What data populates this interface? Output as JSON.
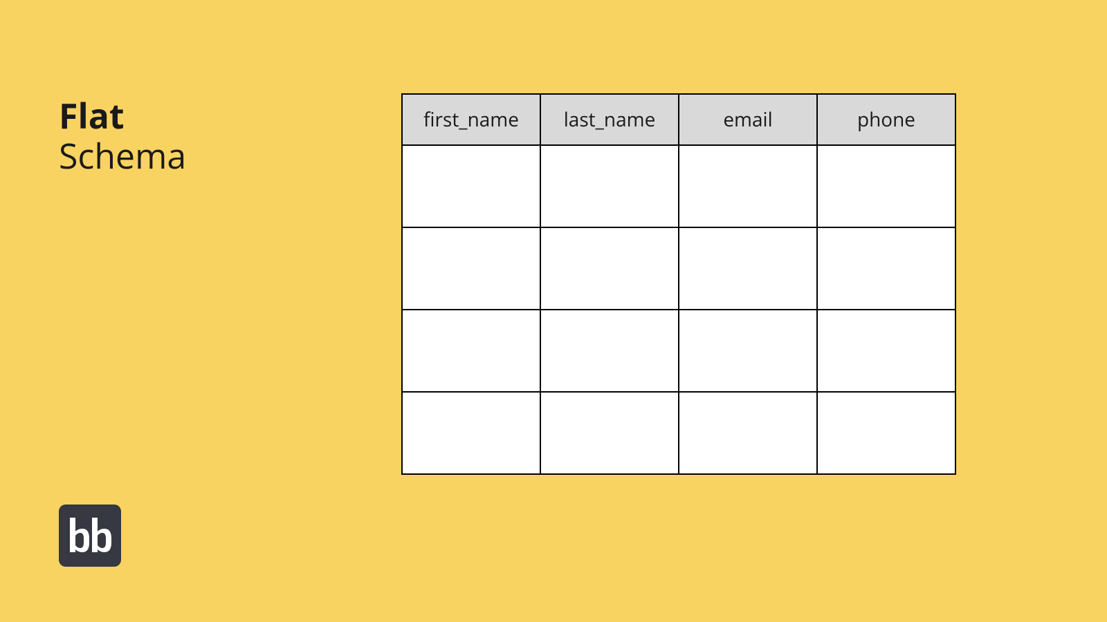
{
  "title": {
    "line1": "Flat",
    "line2": "Schema"
  },
  "logo": {
    "text": "bb"
  },
  "table": {
    "headers": [
      "first_name",
      "last_name",
      "email",
      "phone"
    ],
    "rows": [
      [
        "",
        "",
        "",
        ""
      ],
      [
        "",
        "",
        "",
        ""
      ],
      [
        "",
        "",
        "",
        ""
      ],
      [
        "",
        "",
        "",
        ""
      ]
    ]
  }
}
